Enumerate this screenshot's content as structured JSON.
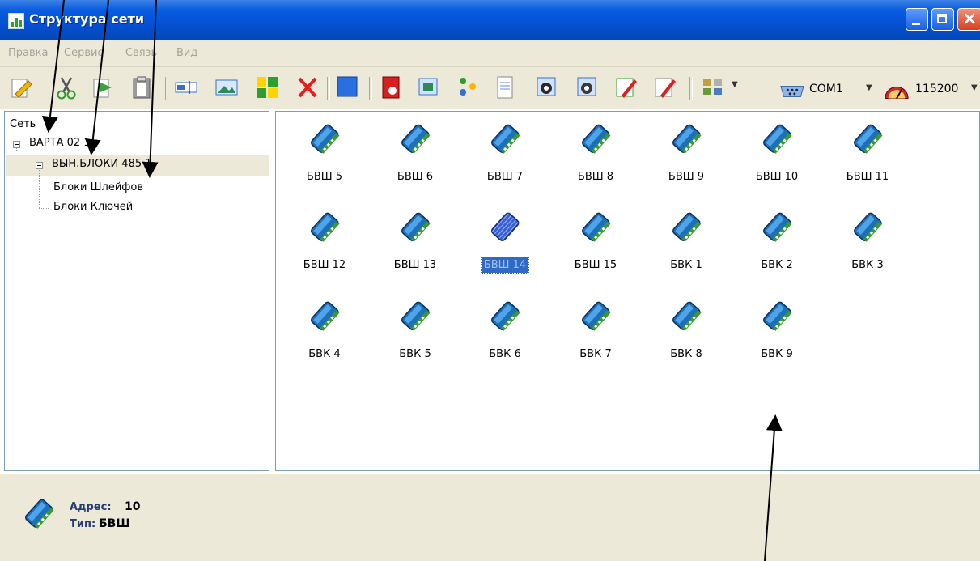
{
  "window": {
    "title": "Структура сети"
  },
  "menu": [
    "Правка",
    "Сервис",
    "Связь",
    "Вид"
  ],
  "toolbar": {
    "port_icon": "serial-port-icon",
    "port_label": "COM1",
    "speed_icon": "speedometer-icon",
    "speed_label": "115200"
  },
  "tree": {
    "root": "Сеть",
    "device": "ВАРТА 02 1",
    "sub": "ВЫН.БЛОКИ 485 1",
    "leaves": [
      "Блоки Шлейфов",
      "Блоки Ключей"
    ]
  },
  "blocks": [
    [
      "БВШ 5",
      "БВШ 6",
      "БВШ 7",
      "БВШ 8",
      "БВШ 9",
      "БВШ 10",
      "БВШ 11"
    ],
    [
      "БВШ 12",
      "БВШ 13",
      "БВШ 14",
      "БВШ 15",
      "БВК 1",
      "БВК 2",
      "БВК 3"
    ],
    [
      "БВК 4",
      "БВК 5",
      "БВК 6",
      "БВК 7",
      "БВК 8",
      "БВК 9"
    ]
  ],
  "selected_block": "БВШ 14",
  "status": {
    "address_label": "Адрес:",
    "address_value": "10",
    "type_label": "Тип:",
    "type_value": "БВШ"
  },
  "colors": {
    "titlebar": "#0551d4",
    "chrome": "#ece9d8",
    "selection": "#316ac5"
  }
}
